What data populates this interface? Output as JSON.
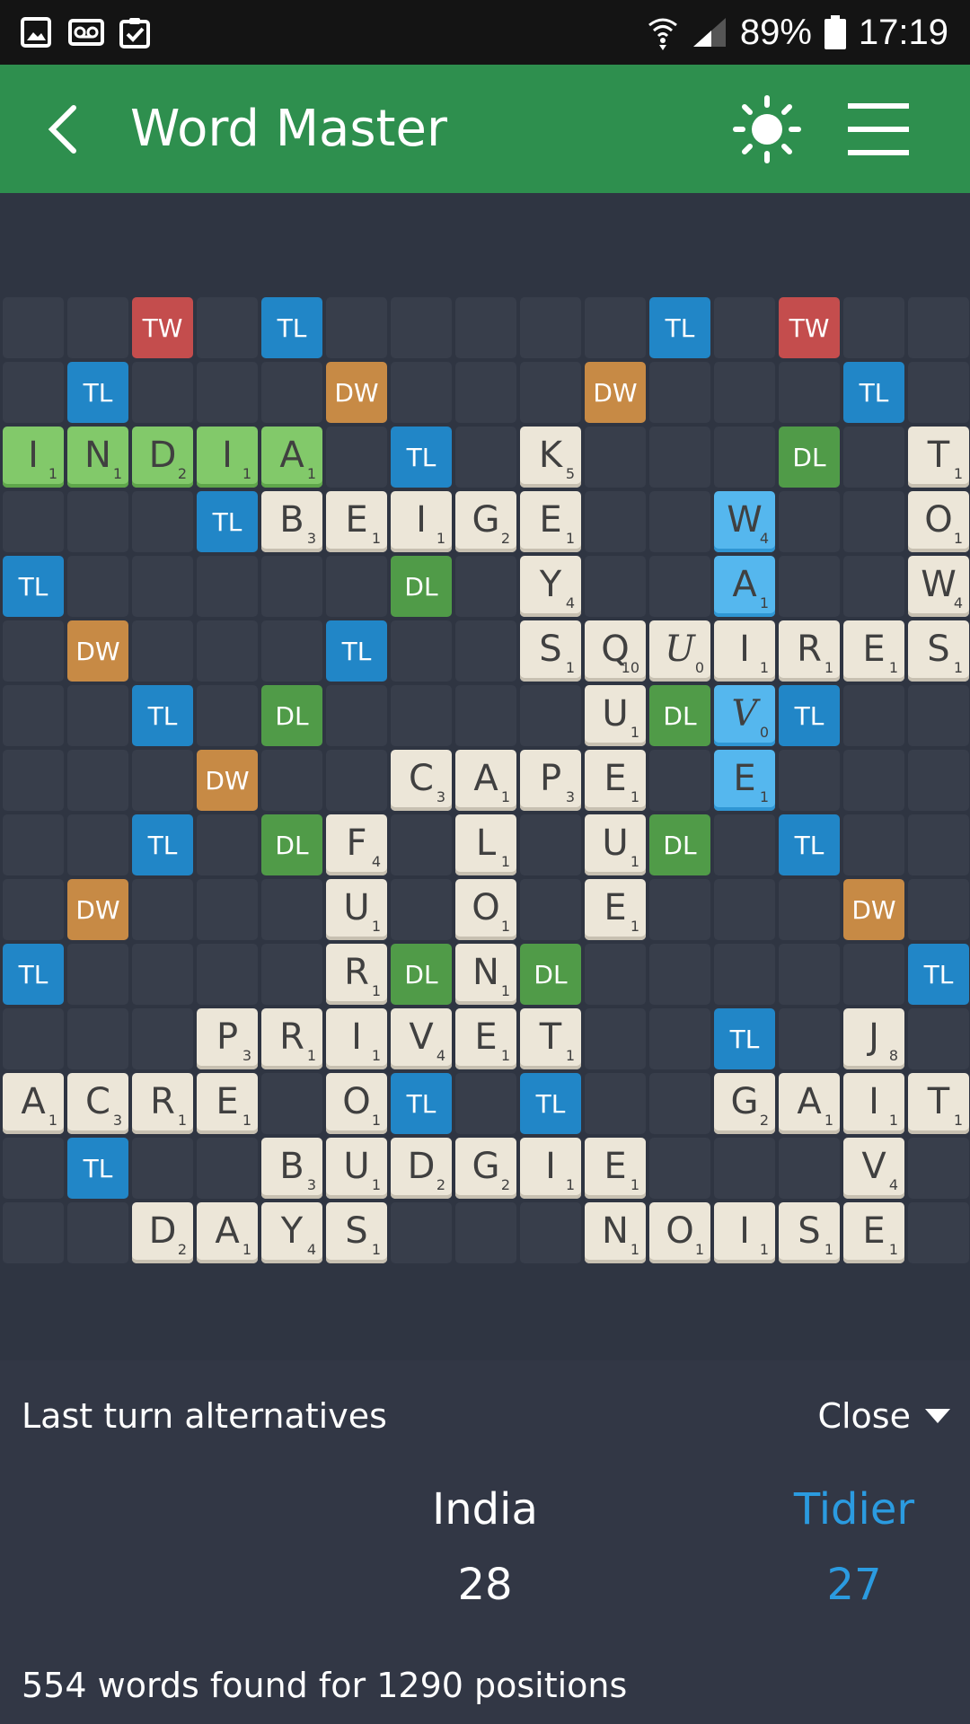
{
  "status_bar": {
    "battery": "89%",
    "time": "17:19",
    "icons": [
      "image-icon",
      "voicemail-icon",
      "clipboard-check-icon",
      "wifi-icon",
      "signal-icon",
      "battery-icon"
    ]
  },
  "app_bar": {
    "title": "Word Master",
    "icons": [
      "back-arrow-icon",
      "brightness-icon",
      "hamburger-menu-icon"
    ]
  },
  "board": {
    "premiums": [
      {
        "r": 0,
        "c": 2,
        "t": "TW"
      },
      {
        "r": 0,
        "c": 4,
        "t": "TL"
      },
      {
        "r": 0,
        "c": 10,
        "t": "TL"
      },
      {
        "r": 0,
        "c": 12,
        "t": "TW"
      },
      {
        "r": 1,
        "c": 1,
        "t": "TL"
      },
      {
        "r": 1,
        "c": 5,
        "t": "DW"
      },
      {
        "r": 1,
        "c": 9,
        "t": "DW"
      },
      {
        "r": 1,
        "c": 13,
        "t": "TL"
      },
      {
        "r": 2,
        "c": 6,
        "t": "TL"
      },
      {
        "r": 2,
        "c": 12,
        "t": "DL"
      },
      {
        "r": 3,
        "c": 3,
        "t": "TL"
      },
      {
        "r": 4,
        "c": 0,
        "t": "TL"
      },
      {
        "r": 4,
        "c": 6,
        "t": "DL"
      },
      {
        "r": 5,
        "c": 1,
        "t": "DW"
      },
      {
        "r": 5,
        "c": 5,
        "t": "TL"
      },
      {
        "r": 6,
        "c": 2,
        "t": "TL"
      },
      {
        "r": 6,
        "c": 4,
        "t": "DL"
      },
      {
        "r": 6,
        "c": 10,
        "t": "DL"
      },
      {
        "r": 6,
        "c": 12,
        "t": "TL"
      },
      {
        "r": 7,
        "c": 3,
        "t": "DW"
      },
      {
        "r": 8,
        "c": 2,
        "t": "TL"
      },
      {
        "r": 8,
        "c": 4,
        "t": "DL"
      },
      {
        "r": 8,
        "c": 10,
        "t": "DL"
      },
      {
        "r": 8,
        "c": 12,
        "t": "TL"
      },
      {
        "r": 9,
        "c": 1,
        "t": "DW"
      },
      {
        "r": 9,
        "c": 13,
        "t": "DW"
      },
      {
        "r": 10,
        "c": 0,
        "t": "TL"
      },
      {
        "r": 10,
        "c": 6,
        "t": "DL"
      },
      {
        "r": 10,
        "c": 8,
        "t": "DL"
      },
      {
        "r": 10,
        "c": 14,
        "t": "TL"
      },
      {
        "r": 11,
        "c": 11,
        "t": "TL"
      },
      {
        "r": 12,
        "c": 6,
        "t": "TL"
      },
      {
        "r": 12,
        "c": 8,
        "t": "TL"
      },
      {
        "r": 13,
        "c": 1,
        "t": "TL"
      }
    ],
    "tiles": [
      {
        "r": 2,
        "c": 0,
        "l": "I",
        "p": "1",
        "s": "green"
      },
      {
        "r": 2,
        "c": 1,
        "l": "N",
        "p": "1",
        "s": "green"
      },
      {
        "r": 2,
        "c": 2,
        "l": "D",
        "p": "2",
        "s": "green"
      },
      {
        "r": 2,
        "c": 3,
        "l": "I",
        "p": "1",
        "s": "green"
      },
      {
        "r": 2,
        "c": 4,
        "l": "A",
        "p": "1",
        "s": "green"
      },
      {
        "r": 2,
        "c": 8,
        "l": "K",
        "p": "5"
      },
      {
        "r": 2,
        "c": 14,
        "l": "T",
        "p": "1"
      },
      {
        "r": 3,
        "c": 4,
        "l": "B",
        "p": "3"
      },
      {
        "r": 3,
        "c": 5,
        "l": "E",
        "p": "1"
      },
      {
        "r": 3,
        "c": 6,
        "l": "I",
        "p": "1"
      },
      {
        "r": 3,
        "c": 7,
        "l": "G",
        "p": "2"
      },
      {
        "r": 3,
        "c": 8,
        "l": "E",
        "p": "1"
      },
      {
        "r": 3,
        "c": 11,
        "l": "W",
        "p": "4",
        "s": "blue"
      },
      {
        "r": 3,
        "c": 14,
        "l": "O",
        "p": "1"
      },
      {
        "r": 4,
        "c": 8,
        "l": "Y",
        "p": "4"
      },
      {
        "r": 4,
        "c": 11,
        "l": "A",
        "p": "1",
        "s": "blue"
      },
      {
        "r": 4,
        "c": 14,
        "l": "W",
        "p": "4"
      },
      {
        "r": 5,
        "c": 8,
        "l": "S",
        "p": "1"
      },
      {
        "r": 5,
        "c": 9,
        "l": "Q",
        "p": "10"
      },
      {
        "r": 5,
        "c": 10,
        "l": "U",
        "p": "0",
        "b": true
      },
      {
        "r": 5,
        "c": 11,
        "l": "I",
        "p": "1"
      },
      {
        "r": 5,
        "c": 12,
        "l": "R",
        "p": "1"
      },
      {
        "r": 5,
        "c": 13,
        "l": "E",
        "p": "1"
      },
      {
        "r": 5,
        "c": 14,
        "l": "S",
        "p": "1"
      },
      {
        "r": 6,
        "c": 9,
        "l": "U",
        "p": "1"
      },
      {
        "r": 6,
        "c": 11,
        "l": "V",
        "p": "0",
        "s": "blue",
        "b": true
      },
      {
        "r": 7,
        "c": 6,
        "l": "C",
        "p": "3"
      },
      {
        "r": 7,
        "c": 7,
        "l": "A",
        "p": "1"
      },
      {
        "r": 7,
        "c": 8,
        "l": "P",
        "p": "3"
      },
      {
        "r": 7,
        "c": 9,
        "l": "E",
        "p": "1"
      },
      {
        "r": 7,
        "c": 11,
        "l": "E",
        "p": "1",
        "s": "blue"
      },
      {
        "r": 8,
        "c": 5,
        "l": "F",
        "p": "4"
      },
      {
        "r": 8,
        "c": 7,
        "l": "L",
        "p": "1"
      },
      {
        "r": 8,
        "c": 9,
        "l": "U",
        "p": "1"
      },
      {
        "r": 9,
        "c": 5,
        "l": "U",
        "p": "1"
      },
      {
        "r": 9,
        "c": 7,
        "l": "O",
        "p": "1"
      },
      {
        "r": 9,
        "c": 9,
        "l": "E",
        "p": "1"
      },
      {
        "r": 10,
        "c": 5,
        "l": "R",
        "p": "1"
      },
      {
        "r": 10,
        "c": 7,
        "l": "N",
        "p": "1"
      },
      {
        "r": 11,
        "c": 3,
        "l": "P",
        "p": "3"
      },
      {
        "r": 11,
        "c": 4,
        "l": "R",
        "p": "1"
      },
      {
        "r": 11,
        "c": 5,
        "l": "I",
        "p": "1"
      },
      {
        "r": 11,
        "c": 6,
        "l": "V",
        "p": "4"
      },
      {
        "r": 11,
        "c": 7,
        "l": "E",
        "p": "1"
      },
      {
        "r": 11,
        "c": 8,
        "l": "T",
        "p": "1"
      },
      {
        "r": 11,
        "c": 13,
        "l": "J",
        "p": "8"
      },
      {
        "r": 12,
        "c": 0,
        "l": "A",
        "p": "1"
      },
      {
        "r": 12,
        "c": 1,
        "l": "C",
        "p": "3"
      },
      {
        "r": 12,
        "c": 2,
        "l": "R",
        "p": "1"
      },
      {
        "r": 12,
        "c": 3,
        "l": "E",
        "p": "1"
      },
      {
        "r": 12,
        "c": 5,
        "l": "O",
        "p": "1"
      },
      {
        "r": 12,
        "c": 11,
        "l": "G",
        "p": "2"
      },
      {
        "r": 12,
        "c": 12,
        "l": "A",
        "p": "1"
      },
      {
        "r": 12,
        "c": 13,
        "l": "I",
        "p": "1"
      },
      {
        "r": 12,
        "c": 14,
        "l": "T",
        "p": "1"
      },
      {
        "r": 13,
        "c": 4,
        "l": "B",
        "p": "3"
      },
      {
        "r": 13,
        "c": 5,
        "l": "U",
        "p": "1"
      },
      {
        "r": 13,
        "c": 6,
        "l": "D",
        "p": "2"
      },
      {
        "r": 13,
        "c": 7,
        "l": "G",
        "p": "2"
      },
      {
        "r": 13,
        "c": 8,
        "l": "I",
        "p": "1"
      },
      {
        "r": 13,
        "c": 9,
        "l": "E",
        "p": "1"
      },
      {
        "r": 13,
        "c": 13,
        "l": "V",
        "p": "4"
      },
      {
        "r": 14,
        "c": 2,
        "l": "D",
        "p": "2"
      },
      {
        "r": 14,
        "c": 3,
        "l": "A",
        "p": "1"
      },
      {
        "r": 14,
        "c": 4,
        "l": "Y",
        "p": "4"
      },
      {
        "r": 14,
        "c": 5,
        "l": "S",
        "p": "1"
      },
      {
        "r": 14,
        "c": 9,
        "l": "N",
        "p": "1"
      },
      {
        "r": 14,
        "c": 10,
        "l": "O",
        "p": "1"
      },
      {
        "r": 14,
        "c": 11,
        "l": "I",
        "p": "1"
      },
      {
        "r": 14,
        "c": 12,
        "l": "S",
        "p": "1"
      },
      {
        "r": 14,
        "c": 13,
        "l": "E",
        "p": "1"
      }
    ]
  },
  "panel": {
    "title": "Last turn alternatives",
    "close_label": "Close",
    "players": [
      {
        "name": "India",
        "score": "28",
        "color": "#ffffff"
      },
      {
        "name": "Tidier",
        "score": "27",
        "color": "#2b9be0"
      }
    ],
    "footer": "554 words found for 1290 positions"
  },
  "colors": {
    "app_bar": "#2e8f4e",
    "background": "#2f3542",
    "tw": "#c44d4d",
    "dw": "#c78a45",
    "tl": "#2186c7",
    "dl": "#509b48",
    "tile": "#ece6d8",
    "tile_last_move": "#82c96a",
    "tile_current": "#55b7ee"
  }
}
